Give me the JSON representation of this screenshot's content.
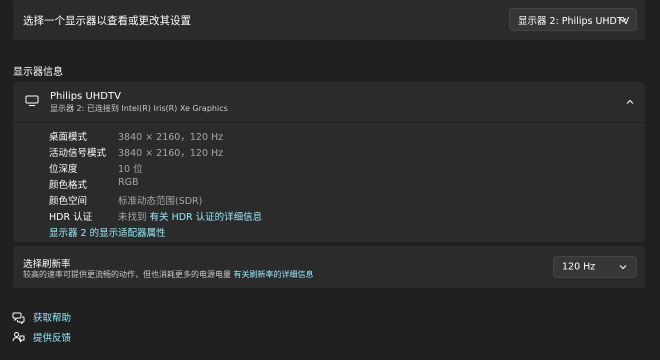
{
  "select_display": {
    "label": "选择一个显示器以查看或更改其设置",
    "selected": "显示器 2: Philips UHDTV"
  },
  "section_title": "显示器信息",
  "monitor": {
    "name": "Philips UHDTV",
    "subtitle": "显示器 2: 已连接到 Intel(R) Iris(R) Xe Graphics",
    "rows": [
      {
        "key": "桌面模式",
        "value": "3840 × 2160，120 Hz"
      },
      {
        "key": "活动信号模式",
        "value": "3840 × 2160，120 Hz"
      },
      {
        "key": "位深度",
        "value": "10 位"
      },
      {
        "key": "颜色格式",
        "value": "RGB"
      },
      {
        "key": "颜色空间",
        "value": "标准动态范围(SDR)"
      }
    ],
    "hdr": {
      "key": "HDR 认证",
      "prefix": "未找到",
      "link": "有关 HDR 认证的详细信息"
    },
    "adapter_link": "显示器 2 的显示适配器属性"
  },
  "refresh": {
    "title": "选择刷新率",
    "description": "较高的速率可提供更流畅的动作，但也消耗更多的电源电量",
    "link": "有关刷新率的详细信息",
    "selected": "120 Hz"
  },
  "footer": {
    "help": "获取帮助",
    "feedback": "提供反馈"
  },
  "colors": {
    "background": "#202020",
    "card": "#2b2b2b",
    "link": "#99ebff"
  }
}
